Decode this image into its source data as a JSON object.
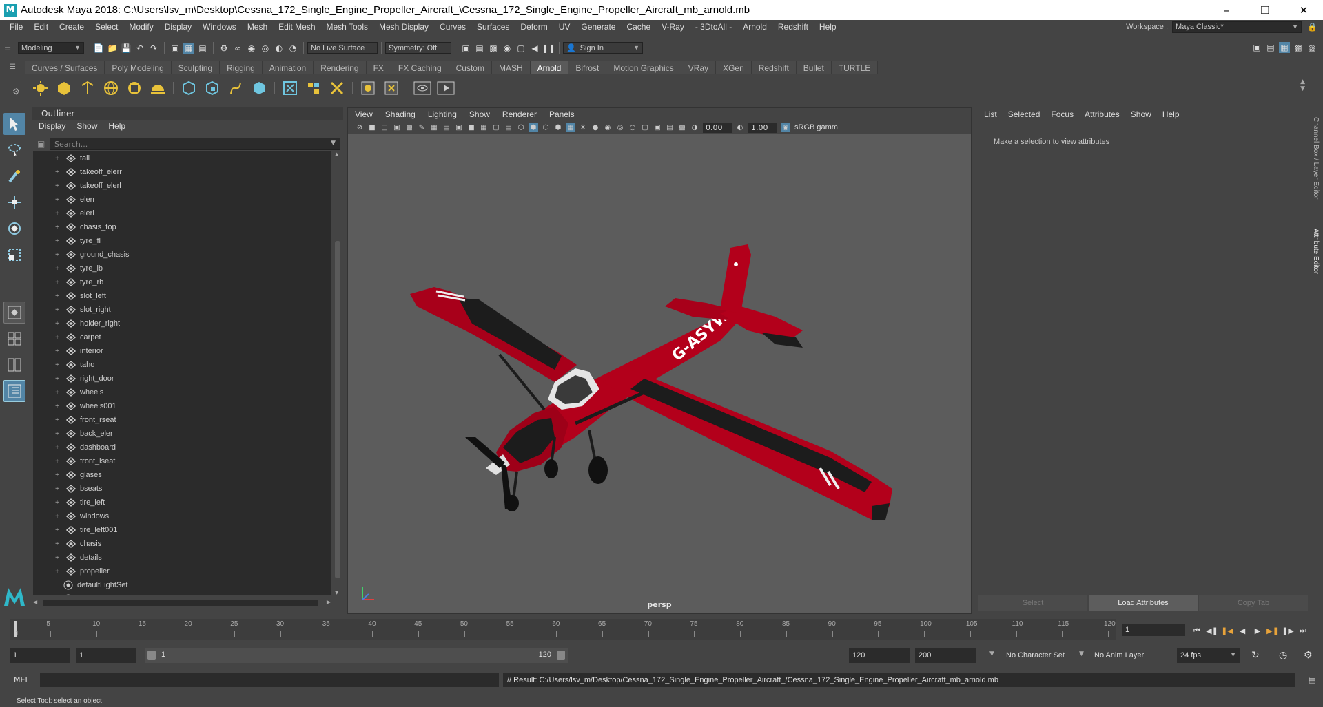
{
  "window": {
    "title": "Autodesk Maya 2018: C:\\Users\\lsv_m\\Desktop\\Cessna_172_Single_Engine_Propeller_Aircraft_\\Cessna_172_Single_Engine_Propeller_Aircraft_mb_arnold.mb",
    "logo_letter": "M"
  },
  "menubar": {
    "items": [
      "File",
      "Edit",
      "Create",
      "Select",
      "Modify",
      "Display",
      "Windows",
      "Mesh",
      "Edit Mesh",
      "Mesh Tools",
      "Mesh Display",
      "Curves",
      "Surfaces",
      "Deform",
      "UV",
      "Generate",
      "Cache",
      "V-Ray",
      "- 3DtoAll -",
      "Arnold",
      "Redshift",
      "Help"
    ],
    "workspace_label": "Workspace :",
    "workspace_value": "Maya Classic*"
  },
  "statusline": {
    "menuset": "Modeling",
    "live_surface": "No Live Surface",
    "symmetry": "Symmetry: Off",
    "sign_in": "Sign In"
  },
  "shelf": {
    "tabs": [
      "Curves / Surfaces",
      "Poly Modeling",
      "Sculpting",
      "Rigging",
      "Animation",
      "Rendering",
      "FX",
      "FX Caching",
      "Custom",
      "MASH",
      "Arnold",
      "Bifrost",
      "Motion Graphics",
      "VRay",
      "XGen",
      "Redshift",
      "Bullet",
      "TURTLE"
    ],
    "active_tab": "Arnold"
  },
  "outliner": {
    "title": "Outliner",
    "menus": [
      "Display",
      "Show",
      "Help"
    ],
    "search_placeholder": "Search...",
    "items": [
      "tail",
      "takeoff_elerr",
      "takeoff_elerl",
      "elerr",
      "elerl",
      "chasis_top",
      "tyre_fl",
      "ground_chasis",
      "tyre_lb",
      "tyre_rb",
      "slot_left",
      "slot_right",
      "holder_right",
      "carpet",
      "interior",
      "taho",
      "right_door",
      "wheels",
      "wheels001",
      "front_rseat",
      "back_eler",
      "dashboard",
      "front_lseat",
      "glases",
      "bseats",
      "tire_left",
      "windows",
      "tire_left001",
      "chasis",
      "details",
      "propeller"
    ],
    "sets": [
      "defaultLightSet",
      "defaultObjectSet"
    ]
  },
  "viewport": {
    "menus": [
      "View",
      "Shading",
      "Lighting",
      "Show",
      "Renderer",
      "Panels"
    ],
    "exposure": "0.00",
    "gamma": "1.00",
    "colorspace": "sRGB gamm",
    "camera": "persp",
    "aircraft_reg": "G-ASYW",
    "colors": {
      "body": "#b3001b",
      "dark": "#1c1c1c",
      "bg": "#5c5c5c"
    }
  },
  "attribute_editor": {
    "menus": [
      "List",
      "Selected",
      "Focus",
      "Attributes",
      "Show",
      "Help"
    ],
    "message": "Make a selection to view attributes",
    "buttons": [
      "Select",
      "Load Attributes",
      "Copy Tab"
    ],
    "side_tabs": [
      "Channel Box / Layer Editor",
      "Attribute Editor"
    ]
  },
  "timeline": {
    "ticks": [
      "1",
      "5",
      "10",
      "15",
      "20",
      "25",
      "30",
      "35",
      "40",
      "45",
      "50",
      "55",
      "60",
      "65",
      "70",
      "75",
      "80",
      "85",
      "90",
      "95",
      "100",
      "105",
      "110",
      "115",
      "120"
    ],
    "current_frame": "1"
  },
  "range": {
    "start": "1",
    "playback_start": "1",
    "slider_start": "1",
    "slider_end": "120",
    "playback_end": "120",
    "end": "200",
    "character_set": "No Character Set",
    "anim_layer": "No Anim Layer",
    "fps": "24 fps"
  },
  "command": {
    "label": "MEL",
    "result": "// Result: C:/Users/lsv_m/Desktop/Cessna_172_Single_Engine_Propeller_Aircraft_/Cessna_172_Single_Engine_Propeller_Aircraft_mb_arnold.mb"
  },
  "helpline": "Select Tool: select an object"
}
